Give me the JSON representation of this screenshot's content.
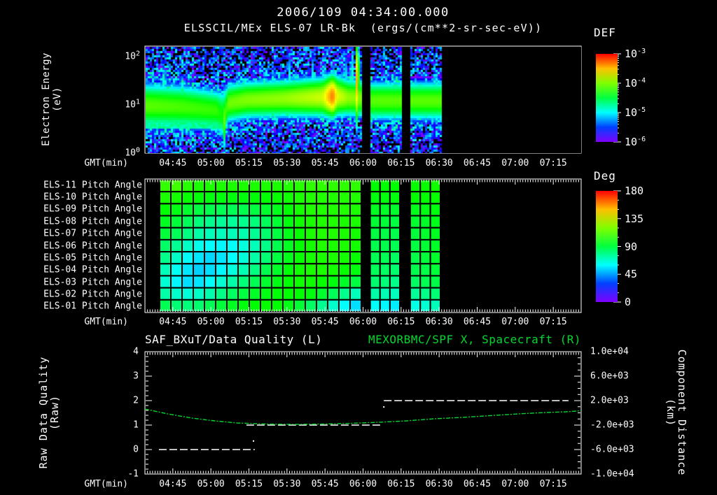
{
  "header": {
    "timestamp": "2006/109 04:34:00.000",
    "instrument_title": "ELSSCIL/MEx ELS-07 LR-Bk  (ergs/(cm**2-sr-sec-eV))"
  },
  "colors": {
    "background": "#000000",
    "foreground": "#ffffff",
    "orbit_green": "#00d830"
  },
  "time_axis": {
    "label": "GMT(min)",
    "start_time": "04:34:00",
    "duration_min": 172,
    "tick_labels": [
      "04:45",
      "05:00",
      "05:15",
      "05:30",
      "05:45",
      "06:00",
      "06:15",
      "06:30",
      "06:45",
      "07:00",
      "07:15"
    ],
    "tick_min": [
      11,
      26,
      41,
      56,
      71,
      86,
      101,
      116,
      131,
      146,
      161
    ]
  },
  "chart_data": [
    {
      "type": "heatmap",
      "id": "electron-energy-spectrogram",
      "title": "ELSSCIL/MEx ELS-07 LR-Bk",
      "units": "ergs/(cm**2-sr-sec-eV)",
      "ylabel_line1": "Electron Energy",
      "ylabel_line2": "(eV)",
      "y_scale": "log",
      "y_range_eV": [
        0.95,
        182
      ],
      "ytick_exponents": [
        0,
        1,
        2
      ],
      "colorbar": {
        "label": "DEF",
        "tick_exponents": [
          -3,
          -4,
          -5,
          -6
        ],
        "scale": "log"
      },
      "data_start_min": 0,
      "data_end_min": 116.5,
      "gaps_min": [
        [
          85.5,
          88.5
        ],
        [
          101,
          104.5
        ]
      ],
      "band_keyframes_t_center_sigma_peak": [
        [
          0,
          1.0,
          0.3,
          -4.1
        ],
        [
          15,
          0.97,
          0.3,
          -4.15
        ],
        [
          28,
          0.9,
          0.28,
          -4.2
        ],
        [
          31,
          0.8,
          0.34,
          -4.35
        ],
        [
          33,
          1.05,
          0.26,
          -4.05
        ],
        [
          40,
          1.12,
          0.25,
          -4.0
        ],
        [
          55,
          1.15,
          0.25,
          -3.95
        ],
        [
          70,
          1.18,
          0.26,
          -3.8
        ],
        [
          74,
          1.2,
          0.27,
          -3.3
        ],
        [
          76,
          1.2,
          0.26,
          -3.75
        ],
        [
          80,
          1.17,
          0.25,
          -3.95
        ],
        [
          85,
          1.15,
          0.25,
          -4.0
        ],
        [
          89,
          1.1,
          0.26,
          -4.1
        ],
        [
          100,
          1.1,
          0.26,
          -4.1
        ],
        [
          105,
          1.1,
          0.26,
          -4.1
        ],
        [
          116.5,
          1.1,
          0.26,
          -4.1
        ]
      ],
      "low_energy_shelf": {
        "t_end_min": 31,
        "logE_range": [
          0.5,
          0.95
        ],
        "log_flux": -4.75
      },
      "streaks_t_strength_center_width": [
        [
          31.5,
          1.1,
          0.7,
          0.5
        ],
        [
          57,
          0.5,
          1.5,
          0.6
        ],
        [
          66,
          0.5,
          1.5,
          0.6
        ],
        [
          79,
          0.8,
          1.6,
          0.5
        ],
        [
          81.5,
          1.0,
          1.6,
          0.5
        ],
        [
          83.5,
          1.3,
          1.5,
          0.7
        ],
        [
          84.5,
          1.0,
          1.6,
          0.5
        ]
      ],
      "noise_log_flux_range": [
        -6.6,
        -5.15
      ],
      "flux_color_range_exponents": [
        -6,
        -3
      ]
    },
    {
      "type": "heatmap",
      "id": "pitch-angle-grid",
      "row_labels": [
        "ELS-11 Pitch Angle",
        "ELS-10 Pitch Angle",
        "ELS-09 Pitch Angle",
        "ELS-08 Pitch Angle",
        "ELS-07 Pitch Angle",
        "ELS-06 Pitch Angle",
        "ELS-05 Pitch Angle",
        "ELS-04 Pitch Angle",
        "ELS-03 Pitch Angle",
        "ELS-02 Pitch Angle",
        "ELS-01 Pitch Angle"
      ],
      "colorbar": {
        "label": "Deg",
        "ticks": [
          180,
          135,
          90,
          45,
          0
        ],
        "range_deg": [
          0,
          180
        ]
      },
      "segments": [
        {
          "start_min": 5.8,
          "end_min": 85.3,
          "cols": 18
        },
        {
          "start_min": 88.8,
          "end_min": 100.5,
          "cols": 3
        },
        {
          "start_min": 104.6,
          "end_min": 116.5,
          "cols": 3
        }
      ],
      "values_deg": [
        [
          108,
          110,
          106,
          104,
          104,
          104,
          104,
          104,
          104,
          104,
          104,
          105,
          106,
          107,
          107,
          107,
          107,
          107,
          100,
          100,
          100,
          101,
          101,
          102
        ],
        [
          104,
          103,
          101,
          99,
          98,
          98,
          98,
          98,
          99,
          100,
          101,
          102,
          104,
          105,
          105,
          105,
          105,
          105,
          98,
          98,
          98,
          100,
          100,
          101
        ],
        [
          100,
          97,
          93,
          90,
          88,
          87,
          87,
          88,
          90,
          93,
          96,
          100,
          103,
          105,
          105,
          105,
          105,
          104,
          95,
          94,
          93,
          96,
          97,
          98
        ],
        [
          95,
          91,
          86,
          81,
          78,
          76,
          76,
          78,
          81,
          86,
          92,
          98,
          102,
          104,
          105,
          105,
          104,
          104,
          92,
          91,
          90,
          93,
          94,
          96
        ],
        [
          91,
          86,
          80,
          74,
          71,
          70,
          71,
          73,
          77,
          83,
          90,
          96,
          101,
          104,
          105,
          105,
          104,
          103,
          90,
          89,
          88,
          91,
          93,
          95
        ],
        [
          84,
          77,
          69,
          63,
          60,
          59,
          61,
          65,
          71,
          79,
          88,
          95,
          100,
          103,
          105,
          104,
          104,
          103,
          88,
          88,
          87,
          90,
          92,
          94
        ],
        [
          78,
          69,
          61,
          56,
          54,
          56,
          60,
          66,
          74,
          82,
          90,
          96,
          101,
          103,
          104,
          104,
          103,
          101,
          87,
          87,
          85,
          89,
          91,
          93
        ],
        [
          71,
          62,
          56,
          53,
          55,
          59,
          65,
          72,
          80,
          88,
          94,
          99,
          102,
          104,
          104,
          103,
          101,
          98,
          86,
          85,
          83,
          88,
          89,
          91
        ],
        [
          67,
          59,
          55,
          56,
          61,
          67,
          74,
          81,
          87,
          93,
          97,
          100,
          102,
          102,
          101,
          98,
          94,
          90,
          83,
          81,
          79,
          85,
          87,
          89
        ],
        [
          74,
          68,
          66,
          69,
          73,
          79,
          85,
          90,
          94,
          97,
          99,
          100,
          100,
          98,
          93,
          86,
          78,
          71,
          74,
          72,
          70,
          76,
          79,
          82
        ],
        [
          87,
          82,
          81,
          83,
          87,
          91,
          95,
          98,
          100,
          101,
          100,
          97,
          92,
          85,
          77,
          68,
          60,
          55,
          61,
          59,
          57,
          64,
          67,
          71
        ]
      ]
    },
    {
      "type": "line",
      "id": "quality-and-orbit",
      "left_axis": {
        "label_line1": "Raw Data Quality",
        "label_line2": "(Raw)",
        "range": [
          -1,
          4
        ],
        "ticks": [
          4,
          3,
          2,
          1,
          0,
          -1
        ]
      },
      "right_axis": {
        "label_line1": "Component Distance",
        "label_line2": "(km)",
        "range": [
          -10000,
          10000
        ],
        "tick_labels": [
          "1.0e+04",
          "6.0e+03",
          "2.0e+03",
          "-2.0e+03",
          "-6.0e+03",
          "-1.0e+04"
        ],
        "tick_values": [
          10000,
          6000,
          2000,
          -2000,
          -6000,
          -10000
        ]
      },
      "series": [
        {
          "name": "SAF_BXuT/Data Quality (L)",
          "axis": "left",
          "color": "#ffffff",
          "style": "dashed",
          "segments": [
            {
              "value": 0,
              "t_start": 5.5,
              "t_end": 43.3
            },
            {
              "value": 1,
              "t_start": 40.0,
              "t_end": 93.3
            },
            {
              "value": 2,
              "t_start": 94.2,
              "t_end": 167.0
            }
          ],
          "isolated_points": [
            {
              "t": 42.8,
              "value": 0.35
            },
            {
              "t": 94.2,
              "value": 1.74
            }
          ]
        },
        {
          "name": "MEXORBMC/SPF X, Spacecraft (R)",
          "axis": "right",
          "color": "#00d830",
          "style": "dashed",
          "points_t_km": [
            [
              0,
              630
            ],
            [
              9,
              -170
            ],
            [
              18.5,
              -860
            ],
            [
              27.5,
              -1320
            ],
            [
              36.5,
              -1660
            ],
            [
              48,
              -1830
            ],
            [
              59,
              -1890
            ],
            [
              70,
              -1830
            ],
            [
              81,
              -1720
            ],
            [
              92,
              -1540
            ],
            [
              103,
              -1320
            ],
            [
              114,
              -970
            ],
            [
              125,
              -740
            ],
            [
              136,
              -460
            ],
            [
              147,
              -170
            ],
            [
              158,
              60
            ],
            [
              166,
              170
            ],
            [
              172,
              340
            ]
          ]
        }
      ]
    }
  ]
}
